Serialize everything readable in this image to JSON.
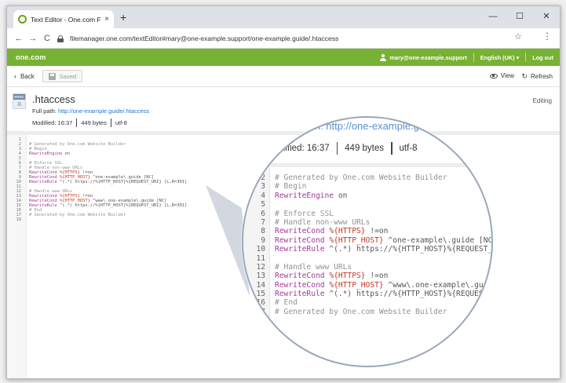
{
  "browser": {
    "tab_title": "Text Editor - One.com File Manag...",
    "tab_close": "×",
    "new_tab": "+",
    "url": "filemanager.one.com/textEditor#mary@one-example.support/one-example.guide/.htaccess",
    "window_controls": [
      "—",
      "☐",
      "✕"
    ],
    "nav": {
      "back": "←",
      "forward": "→",
      "reload": "C",
      "star": "☆",
      "menu": "⋮"
    }
  },
  "header": {
    "logo": "one.com",
    "user_email": "mary@one-example.support",
    "language": "English (UK) ▾",
    "logout": "Log out"
  },
  "actions": {
    "back_label": "Back",
    "back_chevron": "‹",
    "saved_label": "Saved",
    "view_label": "View",
    "refresh_label": "Refresh",
    "refresh_glyph": "↻"
  },
  "file": {
    "icon_tag": "HTAC",
    "icon_letter": "a",
    "name": ".htaccess",
    "full_path_label": "Full path:",
    "full_path_link": "http://one-example.guide/.htaccess",
    "modified_label": "Modified:",
    "modified_time": "16:37",
    "size": "449 bytes",
    "encoding": "utf-8",
    "status": "Editing"
  },
  "code_lines": [
    {
      "n": "1",
      "parts": []
    },
    {
      "n": "2",
      "parts": [
        {
          "c": "cm",
          "t": "# Generated by One.com Website Builder"
        }
      ]
    },
    {
      "n": "3",
      "parts": [
        {
          "c": "cm",
          "t": "# Begin"
        }
      ]
    },
    {
      "n": "4",
      "parts": [
        {
          "c": "kw",
          "t": "RewriteEngine"
        },
        {
          "c": "tx",
          "t": " on"
        }
      ]
    },
    {
      "n": "5",
      "parts": []
    },
    {
      "n": "6",
      "parts": [
        {
          "c": "cm",
          "t": "# Enforce SSL"
        }
      ]
    },
    {
      "n": "7",
      "parts": [
        {
          "c": "cm",
          "t": "# Handle non-www URLs"
        }
      ]
    },
    {
      "n": "8",
      "parts": [
        {
          "c": "kw",
          "t": "RewriteCond"
        },
        {
          "c": "tx",
          "t": " "
        },
        {
          "c": "vr",
          "t": "%{HTTPS}"
        },
        {
          "c": "tx",
          "t": " !=on"
        }
      ]
    },
    {
      "n": "9",
      "parts": [
        {
          "c": "kw",
          "t": "RewriteCond"
        },
        {
          "c": "tx",
          "t": " "
        },
        {
          "c": "vr",
          "t": "%{HTTP_HOST}"
        },
        {
          "c": "tx",
          "t": " ^one-example\\.guide [NC]"
        }
      ]
    },
    {
      "n": "10",
      "parts": [
        {
          "c": "kw",
          "t": "RewriteRule"
        },
        {
          "c": "tx",
          "t": " ^(.*) https://%{HTTP_HOST}%{REQUEST_URI} [L,R=301]"
        }
      ]
    },
    {
      "n": "11",
      "parts": []
    },
    {
      "n": "12",
      "parts": [
        {
          "c": "cm",
          "t": "# Handle www URLs"
        }
      ]
    },
    {
      "n": "13",
      "parts": [
        {
          "c": "kw",
          "t": "RewriteCond"
        },
        {
          "c": "tx",
          "t": " "
        },
        {
          "c": "vr",
          "t": "%{HTTPS}"
        },
        {
          "c": "tx",
          "t": " !=on"
        }
      ]
    },
    {
      "n": "14",
      "parts": [
        {
          "c": "kw",
          "t": "RewriteCond"
        },
        {
          "c": "tx",
          "t": " "
        },
        {
          "c": "vr",
          "t": "%{HTTP_HOST}"
        },
        {
          "c": "tx",
          "t": " ^www\\.one-example\\.guide [NC]"
        }
      ]
    },
    {
      "n": "15",
      "parts": [
        {
          "c": "kw",
          "t": "RewriteRule"
        },
        {
          "c": "tx",
          "t": " ^(.*) https://%{HTTP_HOST}%{REQUEST_URI} [L,R=301]"
        }
      ]
    },
    {
      "n": "16",
      "parts": [
        {
          "c": "cm",
          "t": "# End"
        }
      ]
    },
    {
      "n": "17",
      "parts": [
        {
          "c": "cm",
          "t": "# Generated by One.com Website Builder"
        }
      ]
    },
    {
      "n": "18",
      "parts": []
    }
  ],
  "magnifier": {
    "path_fragment": "ath: http://one-example.gui",
    "first_line": 2
  },
  "colors": {
    "brand_green": "#78b234",
    "link_blue": "#2a76c9",
    "keyword_purple": "#a03a9b",
    "variable_red": "#c0392b",
    "comment_gray": "#939393"
  }
}
